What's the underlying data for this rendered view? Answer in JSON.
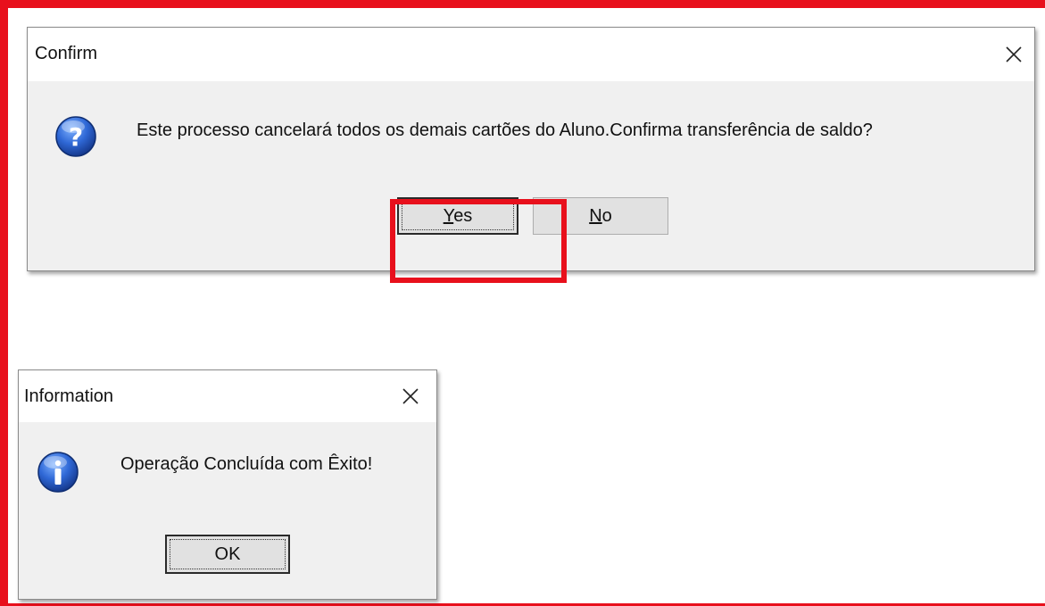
{
  "colors": {
    "annotation_red": "#e8101c",
    "dialog_bg": "#f0f0f0",
    "titlebar_bg": "#ffffff",
    "button_bg": "#e1e1e1"
  },
  "confirm_dialog": {
    "title": "Confirm",
    "close_icon": "close-icon",
    "icon": "question-icon",
    "message": "Este processo cancelará todos os demais cartões do Aluno.Confirma transferência de saldo?",
    "buttons": {
      "yes_accel": "Y",
      "yes_rest": "es",
      "no_accel": "N",
      "no_rest": "o"
    }
  },
  "info_dialog": {
    "title": "Information",
    "close_icon": "close-icon",
    "icon": "information-icon",
    "message": "Operação Concluída com Êxito!",
    "ok_label": "OK"
  }
}
